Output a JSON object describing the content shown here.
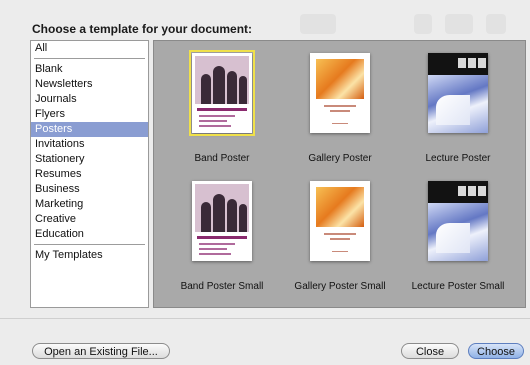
{
  "dialog": {
    "prompt": "Choose a template for your document:"
  },
  "sidebar": {
    "items": [
      {
        "label": "All"
      },
      {
        "label": "Blank"
      },
      {
        "label": "Newsletters"
      },
      {
        "label": "Journals"
      },
      {
        "label": "Flyers"
      },
      {
        "label": "Posters",
        "selected": true
      },
      {
        "label": "Invitations"
      },
      {
        "label": "Stationery"
      },
      {
        "label": "Resumes"
      },
      {
        "label": "Business"
      },
      {
        "label": "Marketing"
      },
      {
        "label": "Creative"
      },
      {
        "label": "Education"
      },
      {
        "label": "My Templates"
      }
    ]
  },
  "templates": [
    {
      "label": "Band Poster",
      "selected": true,
      "style": "band"
    },
    {
      "label": "Gallery Poster",
      "style": "gallery"
    },
    {
      "label": "Lecture Poster",
      "style": "lecture"
    },
    {
      "label": "Band Poster Small",
      "style": "band"
    },
    {
      "label": "Gallery Poster Small",
      "style": "gallery"
    },
    {
      "label": "Lecture Poster Small",
      "style": "lecture"
    }
  ],
  "buttons": {
    "open_existing": "Open an Existing File...",
    "close": "Close",
    "choose": "Choose"
  },
  "colors": {
    "selection": "#8a9dd2",
    "content_bg": "#a9a9a9",
    "thumb_highlight": "#f0e14a"
  }
}
